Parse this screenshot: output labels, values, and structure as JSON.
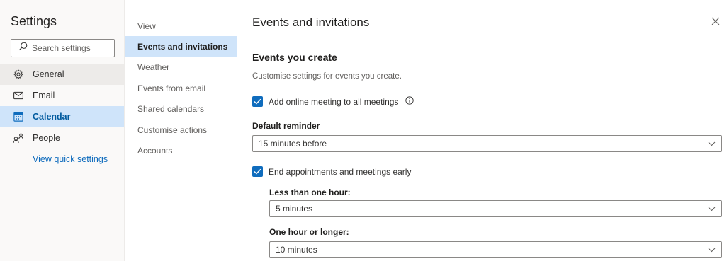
{
  "sidebar": {
    "title": "Settings",
    "search": {
      "placeholder": "Search settings",
      "value": ""
    },
    "items": [
      {
        "label": "General",
        "icon": "gear-icon"
      },
      {
        "label": "Email",
        "icon": "mail-icon"
      },
      {
        "label": "Calendar",
        "icon": "calendar-icon",
        "selected": true
      },
      {
        "label": "People",
        "icon": "people-icon"
      }
    ],
    "quick_link": "View quick settings"
  },
  "subnav": {
    "items": [
      {
        "label": "View"
      },
      {
        "label": "Events and invitations",
        "selected": true
      },
      {
        "label": "Weather"
      },
      {
        "label": "Events from email"
      },
      {
        "label": "Shared calendars"
      },
      {
        "label": "Customise actions"
      },
      {
        "label": "Accounts"
      }
    ]
  },
  "panel": {
    "title": "Events and invitations",
    "section_title": "Events you create",
    "section_desc": "Customise settings for events you create.",
    "online_meeting": {
      "label": "Add online meeting to all meetings",
      "checked": true
    },
    "default_reminder": {
      "label": "Default reminder",
      "value": "15 minutes before"
    },
    "end_early": {
      "label": "End appointments and meetings early",
      "checked": true
    },
    "less_than_hour": {
      "label": "Less than one hour:",
      "value": "5 minutes"
    },
    "hour_or_longer": {
      "label": "One hour or longer:",
      "value": "10 minutes"
    }
  },
  "colors": {
    "accent": "#0f6cbd",
    "selected_bg": "#cfe4fa",
    "sidebar_bg": "#faf9f8"
  }
}
